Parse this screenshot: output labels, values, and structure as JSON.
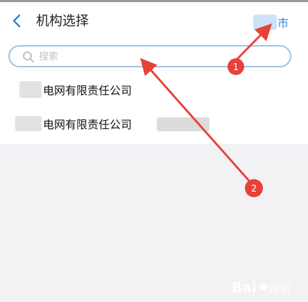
{
  "header": {
    "back_icon": "chevron-left-icon",
    "title": "机构选择",
    "city_suffix": "市"
  },
  "search": {
    "placeholder": "搜索",
    "icon": "search-icon"
  },
  "organizations": [
    {
      "name": "电网有限责任公司"
    },
    {
      "name": "电网有限责任公司"
    }
  ],
  "annotations": [
    {
      "label": "1",
      "color": "#e8413a"
    },
    {
      "label": "2",
      "color": "#e8413a"
    }
  ],
  "colors": {
    "accent": "#2f7fd8",
    "annotation": "#e8413a",
    "search_border": "#9cc4e6"
  }
}
